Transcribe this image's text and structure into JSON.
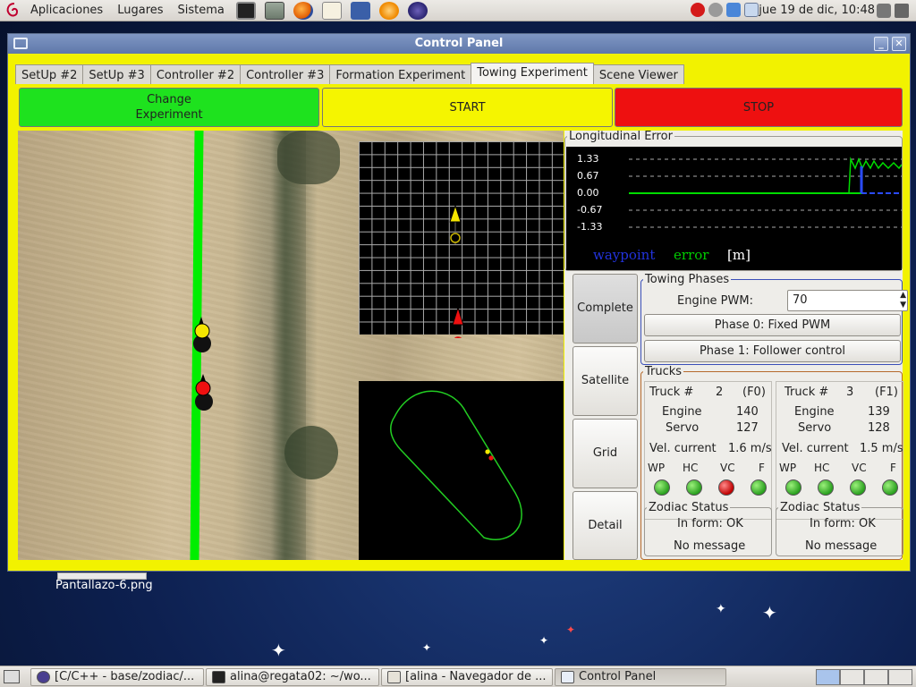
{
  "top_panel": {
    "menus": [
      "Aplicaciones",
      "Lugares",
      "Sistema"
    ],
    "clock": "jue 19 de dic, 10:48",
    "launchers": [
      "terminal-icon",
      "calculator-icon",
      "firefox-icon",
      "tex-icon",
      "r-icon",
      "blender-icon",
      "eclipse-icon"
    ]
  },
  "window": {
    "title": "Control Panel",
    "tabs": [
      "SetUp #2",
      "SetUp #3",
      "Controller #2",
      "Controller #3",
      "Formation Experiment",
      "Towing Experiment",
      "Scene Viewer"
    ],
    "active_tab": "Towing Experiment",
    "buttons": {
      "change_line1": "Change",
      "change_line2": "Experiment",
      "start": "START",
      "stop": "STOP",
      "change_color": "#1ee21e",
      "start_color": "#f5f500",
      "stop_color": "#ee1010"
    }
  },
  "map": {
    "track_color": "#00ee00"
  },
  "long_error": {
    "title": "Longitudinal Error",
    "yticks": [
      "1.33",
      "0.67",
      "0.00",
      "-0.67",
      "-1.33"
    ],
    "legend_waypoint": "waypoint",
    "legend_error": "error",
    "legend_unit": "[m]"
  },
  "view_buttons": [
    "Complete",
    "Satellite",
    "Grid",
    "Detail"
  ],
  "towing": {
    "title": "Towing Phases",
    "pwm_label": "Engine PWM:",
    "pwm_value": "70",
    "phase0": "Phase 0: Fixed PWM",
    "phase1": "Phase 1: Follower control"
  },
  "trucks": {
    "title": "Trucks",
    "list": [
      {
        "label": "Truck #",
        "num": "2",
        "id": "(F0)",
        "engine_label": "Engine",
        "engine": "140",
        "servo_label": "Servo",
        "servo": "127",
        "vel_label": "Vel. current",
        "vel": "1.6 m/s",
        "leds": [
          "WP",
          "HC",
          "VC",
          "F"
        ],
        "led_states": [
          "green",
          "green",
          "red",
          "green"
        ],
        "status_title": "Zodiac Status",
        "status_form": "In form: OK",
        "status_msg": "No message"
      },
      {
        "label": "Truck #",
        "num": "3",
        "id": "(F1)",
        "engine_label": "Engine",
        "engine": "139",
        "servo_label": "Servo",
        "servo": "128",
        "vel_label": "Vel. current",
        "vel": "1.5 m/s",
        "leds": [
          "WP",
          "HC",
          "VC",
          "F"
        ],
        "led_states": [
          "green",
          "green",
          "green",
          "green"
        ],
        "status_title": "Zodiac Status",
        "status_form": "In form: OK",
        "status_msg": "No message"
      }
    ]
  },
  "desktop": {
    "icon_label": "Pantallazo-6.png"
  },
  "taskbar": {
    "tasks": [
      "[C/C++ - base/zodiac/...",
      "alina@regata02: ~/wo...",
      "[alina - Navegador de ...",
      "Control Panel"
    ]
  }
}
